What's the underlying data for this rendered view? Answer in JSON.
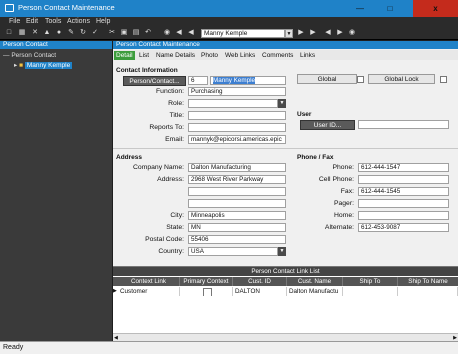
{
  "window": {
    "title": "Person Contact Maintenance"
  },
  "menu": [
    "File",
    "Edit",
    "Tools",
    "Actions",
    "Help"
  ],
  "toolbar": {
    "current_record": "Manny Kemple"
  },
  "left_panel": {
    "title": "Person Contact",
    "tree_root": "Person Contact",
    "tree_child": "Manny Kemple"
  },
  "right_panel": {
    "title": "Person Contact Maintenance"
  },
  "tabs": [
    "Detail",
    "List",
    "Name Details",
    "Photo",
    "Web Links",
    "Comments",
    "Links"
  ],
  "contact_info": {
    "section": "Contact Information",
    "person_contact_button": "Person/Contact...",
    "id": "6",
    "name": "Manny Kemple",
    "function_label": "Function:",
    "function": "Purchasing",
    "role_label": "Role:",
    "role": "",
    "title_label": "Title:",
    "title": "",
    "reports_to_label": "Reports To:",
    "reports_to": "",
    "email_label": "Email:",
    "email": "mannyk@epicorsi.americas.epic",
    "global_button": "Global",
    "global_lock_button": "Global Lock"
  },
  "user": {
    "section": "User",
    "user_id_button": "User ID...",
    "user_id": ""
  },
  "address": {
    "section": "Address",
    "company_label": "Company Name:",
    "company": "Dalton Manufacturing",
    "address_label": "Address:",
    "line1": "2968 West River Parkway",
    "line2": "",
    "line3": "",
    "city_label": "City:",
    "city": "Minneapolis",
    "state_label": "State:",
    "state": "MN",
    "postal_label": "Postal Code:",
    "postal": "55406",
    "country_label": "Country:",
    "country": "USA"
  },
  "phone": {
    "section": "Phone / Fax",
    "phone_label": "Phone:",
    "phone": "612-444-1547",
    "cell_label": "Cell Phone:",
    "cell": "",
    "fax_label": "Fax:",
    "fax": "612-444-1545",
    "pager_label": "Pager:",
    "pager": "",
    "home_label": "Home:",
    "home": "",
    "alt_label": "Alternate:",
    "alt": "612-453-9087"
  },
  "link_list": {
    "title": "Person Contact Link List",
    "columns": [
      "Context Link",
      "Primary Context",
      "Cust. ID",
      "Cust. Name",
      "Ship To",
      "Ship To Name"
    ],
    "row": {
      "context": "Customer",
      "cust_id": "DALTON",
      "cust_name": "Dalton Manufactu"
    }
  },
  "status": {
    "text": "Ready"
  }
}
